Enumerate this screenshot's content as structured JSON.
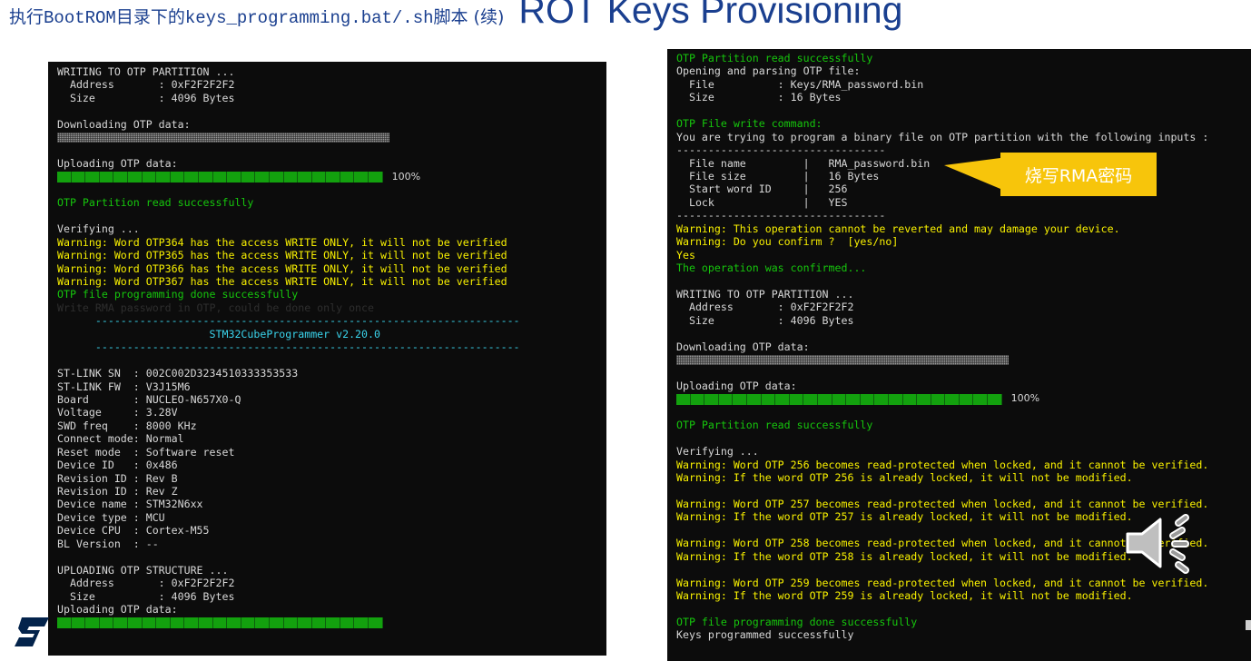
{
  "title": {
    "prefix": "执行",
    "bootrom": "BootROM",
    "middle": "目录下的",
    "script": "keys_programming.bat/.sh",
    "suffix": "脚本 (续)",
    "heading": "ROT Keys Provisioning"
  },
  "left_terminal": {
    "lines": [
      {
        "t": "WRITING TO OTP PARTITION ...",
        "c": "w"
      },
      {
        "t": "  Address       : 0xF2F2F2F2",
        "c": "w"
      },
      {
        "t": "  Size          : 4096 Bytes",
        "c": "w"
      },
      {
        "t": "",
        "c": "w"
      },
      {
        "t": "Downloading OTP data:",
        "c": "w"
      },
      {
        "bar": "dotted",
        "pct": ""
      },
      {
        "t": "",
        "c": "w"
      },
      {
        "t": "Uploading OTP data:",
        "c": "w"
      },
      {
        "bar": "green",
        "pct": "100%"
      },
      {
        "t": "",
        "c": "w"
      },
      {
        "t": "OTP Partition read successfully",
        "c": "g"
      },
      {
        "t": "",
        "c": "w"
      },
      {
        "t": "Verifying ...",
        "c": "w"
      },
      {
        "t": "Warning: Word OTP364 has the access WRITE ONLY, it will not be verified",
        "c": "y"
      },
      {
        "t": "Warning: Word OTP365 has the access WRITE ONLY, it will not be verified",
        "c": "y"
      },
      {
        "t": "Warning: Word OTP366 has the access WRITE ONLY, it will not be verified",
        "c": "y"
      },
      {
        "t": "Warning: Word OTP367 has the access WRITE ONLY, it will not be verified",
        "c": "y"
      },
      {
        "t": "OTP file programming done successfully",
        "c": "g"
      },
      {
        "t": "Write RMA password in OTP, could be done only once",
        "c": "dim"
      },
      {
        "t": "      -------------------------------------------------------------------",
        "c": "c"
      },
      {
        "t": "                        STM32CubeProgrammer v2.20.0",
        "c": "c"
      },
      {
        "t": "      -------------------------------------------------------------------",
        "c": "c"
      },
      {
        "t": "",
        "c": "w"
      },
      {
        "t": "ST-LINK SN  : 002C002D3234510333353533",
        "c": "w"
      },
      {
        "t": "ST-LINK FW  : V3J15M6",
        "c": "w"
      },
      {
        "t": "Board       : NUCLEO-N657X0-Q",
        "c": "w"
      },
      {
        "t": "Voltage     : 3.28V",
        "c": "w"
      },
      {
        "t": "SWD freq    : 8000 KHz",
        "c": "w"
      },
      {
        "t": "Connect mode: Normal",
        "c": "w"
      },
      {
        "t": "Reset mode  : Software reset",
        "c": "w"
      },
      {
        "t": "Device ID   : 0x486",
        "c": "w"
      },
      {
        "t": "Revision ID : Rev B",
        "c": "w"
      },
      {
        "t": "Revision ID : Rev Z",
        "c": "w"
      },
      {
        "t": "Device name : STM32N6xx",
        "c": "w"
      },
      {
        "t": "Device type : MCU",
        "c": "w"
      },
      {
        "t": "Device CPU  : Cortex-M55",
        "c": "w"
      },
      {
        "t": "BL Version  : --",
        "c": "w"
      },
      {
        "t": "",
        "c": "w"
      },
      {
        "t": "UPLOADING OTP STRUCTURE ...",
        "c": "w"
      },
      {
        "t": "  Address       : 0xF2F2F2F2",
        "c": "w"
      },
      {
        "t": "  Size          : 4096 Bytes",
        "c": "w"
      },
      {
        "t": "Uploading OTP data:",
        "c": "w"
      },
      {
        "bar": "green",
        "pct": ""
      }
    ]
  },
  "right_terminal": {
    "lines": [
      {
        "t": "OTP Partition read successfully",
        "c": "g"
      },
      {
        "t": "Opening and parsing OTP file:",
        "c": "w"
      },
      {
        "t": "  File          : Keys/RMA_password.bin",
        "c": "w"
      },
      {
        "t": "  Size          : 16 Bytes",
        "c": "w"
      },
      {
        "t": "",
        "c": "w"
      },
      {
        "t": "OTP File write command:",
        "c": "g"
      },
      {
        "t": "You are trying to program a binary file on OTP partition with the following inputs :",
        "c": "w"
      },
      {
        "t": "---------------------------------",
        "c": "w"
      },
      {
        "t": "  File name         |   RMA_password.bin",
        "c": "w"
      },
      {
        "t": "  File size         |   16 Bytes",
        "c": "w"
      },
      {
        "t": "  Start word ID     |   256",
        "c": "w"
      },
      {
        "t": "  Lock              |   YES",
        "c": "w"
      },
      {
        "t": "---------------------------------",
        "c": "w"
      },
      {
        "t": "Warning: This operation cannot be reverted and may damage your device.",
        "c": "y"
      },
      {
        "t": "Warning: Do you confirm ?  [yes/no]",
        "c": "y"
      },
      {
        "t": "Yes",
        "c": "y"
      },
      {
        "t": "The operation was confirmed...",
        "c": "g"
      },
      {
        "t": "",
        "c": "w"
      },
      {
        "t": "WRITING TO OTP PARTITION ...",
        "c": "w"
      },
      {
        "t": "  Address       : 0xF2F2F2F2",
        "c": "w"
      },
      {
        "t": "  Size          : 4096 Bytes",
        "c": "w"
      },
      {
        "t": "",
        "c": "w"
      },
      {
        "t": "Downloading OTP data:",
        "c": "w"
      },
      {
        "bar": "dotted",
        "pct": ""
      },
      {
        "t": "",
        "c": "w"
      },
      {
        "t": "Uploading OTP data:",
        "c": "w"
      },
      {
        "bar": "green",
        "pct": "100%"
      },
      {
        "t": "",
        "c": "w"
      },
      {
        "t": "OTP Partition read successfully",
        "c": "g"
      },
      {
        "t": "",
        "c": "w"
      },
      {
        "t": "Verifying ...",
        "c": "w"
      },
      {
        "t": "Warning: Word OTP 256 becomes read-protected when locked, and it cannot be verified.",
        "c": "y"
      },
      {
        "t": "Warning: If the word OTP 256 is already locked, it will not be modified.",
        "c": "y"
      },
      {
        "t": "",
        "c": "w"
      },
      {
        "t": "Warning: Word OTP 257 becomes read-protected when locked, and it cannot be verified.",
        "c": "y"
      },
      {
        "t": "Warning: If the word OTP 257 is already locked, it will not be modified.",
        "c": "y"
      },
      {
        "t": "",
        "c": "w"
      },
      {
        "t": "Warning: Word OTP 258 becomes read-protected when locked, and it cannot be verified.",
        "c": "y"
      },
      {
        "t": "Warning: If the word OTP 258 is already locked, it will not be modified.",
        "c": "y"
      },
      {
        "t": "",
        "c": "w"
      },
      {
        "t": "Warning: Word OTP 259 becomes read-protected when locked, and it cannot be verified.",
        "c": "y"
      },
      {
        "t": "Warning: If the word OTP 259 is already locked, it will not be modified.",
        "c": "y"
      },
      {
        "t": "",
        "c": "w"
      },
      {
        "t": "OTP file programming done successfully",
        "c": "g"
      },
      {
        "t": "Keys programmed successfully",
        "c": "w"
      }
    ]
  },
  "callout": {
    "label": "烧写RMA密码"
  },
  "icons": {
    "speaker": "speaker-icon",
    "logo": "st-logo-icon"
  },
  "colors": {
    "title": "#1a3f8f",
    "terminal_bg": "#0c0c0c",
    "green_text": "#16c60c",
    "yellow_text": "#f9f100",
    "cyan_text": "#3ad4ec",
    "progress_fill": "#13a10e",
    "callout_bg": "#f7c50b"
  }
}
